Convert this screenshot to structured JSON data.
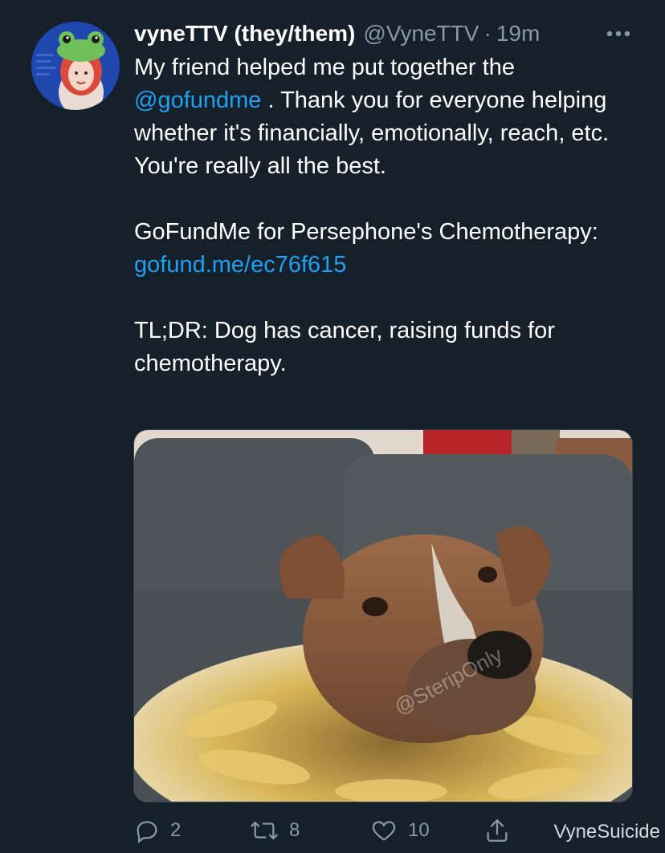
{
  "tweet": {
    "display_name": "vyneTTV (they/them)",
    "handle": "@VyneTTV",
    "separator": "·",
    "time": "19m",
    "body": {
      "line1_prefix": "My friend helped me put together the ",
      "mention": "@gofundme",
      "line1_suffix": " . Thank you for everyone helping whether it's financially, emotionally, reach, etc. You're really all the best.",
      "para2_prefix": "GoFundMe for Persephone's Chemotherapy: ",
      "para2_link": "gofund.me/ec76f615",
      "para3": "TL;DR: Dog has cancer, raising funds for chemotherapy."
    },
    "photo": {
      "watermark_text": "@SteripOnly"
    },
    "actions": {
      "reply_count": "2",
      "retweet_count": "8",
      "like_count": "10"
    }
  },
  "overlay": {
    "watermark": "VyneSuicide"
  },
  "colors": {
    "background": "#15202b",
    "link": "#1da1f2",
    "muted": "#8899a6"
  },
  "icons": [
    "more-icon",
    "reply-icon",
    "retweet-icon",
    "like-icon",
    "share-icon"
  ]
}
